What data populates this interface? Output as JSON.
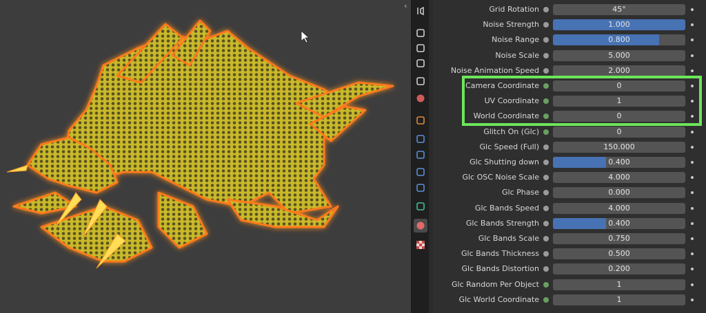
{
  "panel": {
    "rows": [
      {
        "label": "Grid Rotation",
        "value": "45°",
        "fill": 0,
        "dot": "gray"
      },
      {
        "label": "Noise Strength",
        "value": "1.000",
        "fill": 1.0,
        "dot": "gray"
      },
      {
        "label": "Noise Range",
        "value": "0.800",
        "fill": 0.8,
        "dot": "gray"
      },
      {
        "label": "Noise Scale",
        "value": "5.000",
        "fill": 0,
        "dot": "gray"
      },
      {
        "label": "Noise Animation Speed",
        "value": "2.000",
        "fill": 0,
        "dot": "gray"
      },
      {
        "label": "Camera Coordinate",
        "value": "0",
        "fill": 0,
        "dot": "green"
      },
      {
        "label": "UV Coordinate",
        "value": "1",
        "fill": 0,
        "dot": "green"
      },
      {
        "label": "World Coordinate",
        "value": "0",
        "fill": 0,
        "dot": "green"
      },
      {
        "label": "Glitch On (Glc)",
        "value": "0",
        "fill": 0,
        "dot": "green"
      },
      {
        "label": "Glc Speed (Full)",
        "value": "150.000",
        "fill": 0,
        "dot": "gray"
      },
      {
        "label": "Glc Shutting down",
        "value": "0.400",
        "fill": 0.4,
        "dot": "gray"
      },
      {
        "label": "Glc OSC Noise Scale",
        "value": "4.000",
        "fill": 0,
        "dot": "gray"
      },
      {
        "label": "Glc Phase",
        "value": "0.000",
        "fill": 0,
        "dot": "gray"
      },
      {
        "label": "Glc Bands Speed",
        "value": "4.000",
        "fill": 0,
        "dot": "gray"
      },
      {
        "label": "Glc Bands Strength",
        "value": "0.400",
        "fill": 0.4,
        "dot": "gray"
      },
      {
        "label": "Glc Bands Scale",
        "value": "0.750",
        "fill": 0,
        "dot": "gray"
      },
      {
        "label": "Glc Bands Thickness",
        "value": "0.500",
        "fill": 0,
        "dot": "gray"
      },
      {
        "label": "Glc Bands Distortion",
        "value": "0.200",
        "fill": 0,
        "dot": "gray"
      },
      {
        "label": "Glc Random Per Object",
        "value": "1",
        "fill": 0,
        "dot": "green"
      },
      {
        "label": "Glc World Coordinate",
        "value": "1",
        "fill": 0,
        "dot": "green"
      }
    ]
  },
  "sidebar_tabs": [
    {
      "icon": "tool-icon",
      "active": false
    },
    {
      "icon": "render-icon",
      "active": false
    },
    {
      "icon": "output-icon",
      "active": false
    },
    {
      "icon": "view-layer-icon",
      "active": false
    },
    {
      "icon": "scene-icon",
      "active": false
    },
    {
      "icon": "world-icon",
      "active": false
    },
    {
      "icon": "object-icon",
      "active": false
    },
    {
      "icon": "modifier-icon",
      "active": false
    },
    {
      "icon": "particles-icon",
      "active": false
    },
    {
      "icon": "physics-icon",
      "active": false
    },
    {
      "icon": "constraints-icon",
      "active": false
    },
    {
      "icon": "data-icon",
      "active": false
    },
    {
      "icon": "material-icon",
      "active": true
    },
    {
      "icon": "texture-icon",
      "active": false
    }
  ],
  "colors": {
    "accent_fill": "#4772b3",
    "highlight": "#6ce65a",
    "glow": "#ff7a1a",
    "mesh": "#e3d43a"
  }
}
